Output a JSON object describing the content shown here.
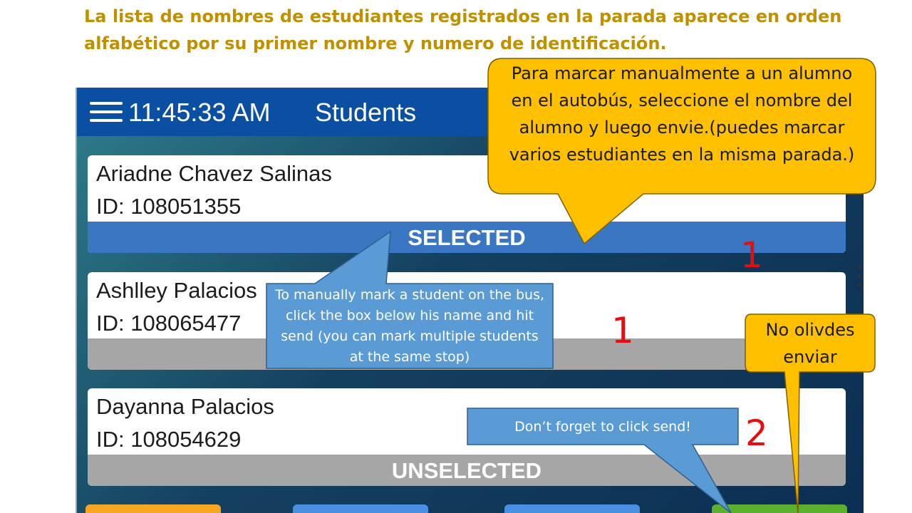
{
  "heading": "La lista de nombres de estudiantes registrados en la parada aparece en orden alfabético por su primer nombre y numero de identificación.",
  "app": {
    "clock": "11:45:33 AM",
    "title": "Students",
    "menu_icon": "hamburger-menu-icon",
    "students": [
      {
        "name": "Ariadne Chavez Salinas",
        "id": "ID: 108051355",
        "status": "SELECTED"
      },
      {
        "name": "Ashlley Palacios",
        "id": "ID: 108065477",
        "status": ""
      },
      {
        "name": "Dayanna Palacios",
        "id": "ID: 108054629",
        "status": "UNSELECTED"
      }
    ],
    "colors": {
      "appbar": "#0b4fa3",
      "selected": "#3a76c2",
      "unselected": "#a6a6a6"
    }
  },
  "callouts": {
    "spanish_manual": "Para marcar manualmente a un alumno en el autobús, seleccione el nombre del alumno y luego envie.(puedes marcar varios estudiantes en la misma parada.)",
    "english_manual": "To manually mark a student on the bus, click the box below his name and hit send (you can mark multiple students at the same stop)",
    "spanish_send": "No olivdes enviar",
    "english_send": "Don’t forget to click send!"
  },
  "markers": {
    "m1a": "1",
    "m1b": "1",
    "m2": "2"
  },
  "bottom_buttons": {
    "colors": [
      "#f5a623",
      "#4a90e2",
      "#4a90e2",
      "#5bb12f"
    ]
  }
}
